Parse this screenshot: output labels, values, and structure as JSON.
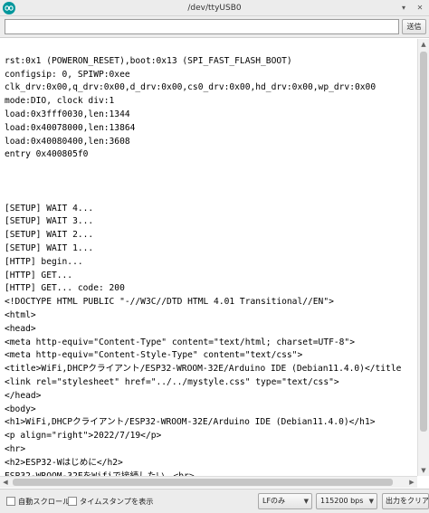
{
  "window": {
    "title": "/dev/ttyUSB0"
  },
  "input": {
    "value": "",
    "send_label": "送信"
  },
  "console_lines": [
    "",
    "rst:0x1 (POWERON_RESET),boot:0x13 (SPI_FAST_FLASH_BOOT)",
    "configsip: 0, SPIWP:0xee",
    "clk_drv:0x00,q_drv:0x00,d_drv:0x00,cs0_drv:0x00,hd_drv:0x00,wp_drv:0x00",
    "mode:DIO, clock div:1",
    "load:0x3fff0030,len:1344",
    "load:0x40078000,len:13864",
    "load:0x40080400,len:3608",
    "entry 0x400805f0",
    "",
    "",
    "",
    "[SETUP] WAIT 4...",
    "[SETUP] WAIT 3...",
    "[SETUP] WAIT 2...",
    "[SETUP] WAIT 1...",
    "[HTTP] begin...",
    "[HTTP] GET...",
    "[HTTP] GET... code: 200",
    "<!DOCTYPE HTML PUBLIC \"-//W3C//DTD HTML 4.01 Transitional//EN\">",
    "<html>",
    "<head>",
    "<meta http-equiv=\"Content-Type\" content=\"text/html; charset=UTF-8\">",
    "<meta http-equiv=\"Content-Style-Type\" content=\"text/css\">",
    "<title>WiFi,DHCPクライアント/ESP32-WROOM-32E/Arduino IDE (Debian11.4.0)</title",
    "<link rel=\"stylesheet\" href=\"../../mystyle.css\" type=\"text/css\">",
    "</head>",
    "<body>",
    "<h1>WiFi,DHCPクライアント/ESP32-WROOM-32E/Arduino IDE (Debian11.4.0)</h1>",
    "<p align=\"right\">2022/7/19</p>",
    "<hr>",
    "<h2>ESP32-Wはじめに</h2>",
    "ESP32-WROOM-32EをWifiで接続したい。<br>"
  ],
  "status": {
    "autoscroll_label": "自動スクロール",
    "autoscroll_checked": false,
    "timestamp_label": "タイムスタンプを表示",
    "timestamp_checked": false,
    "line_ending": "LFのみ",
    "baud_rate": "115200 bps",
    "clear_label": "出力をクリア"
  }
}
